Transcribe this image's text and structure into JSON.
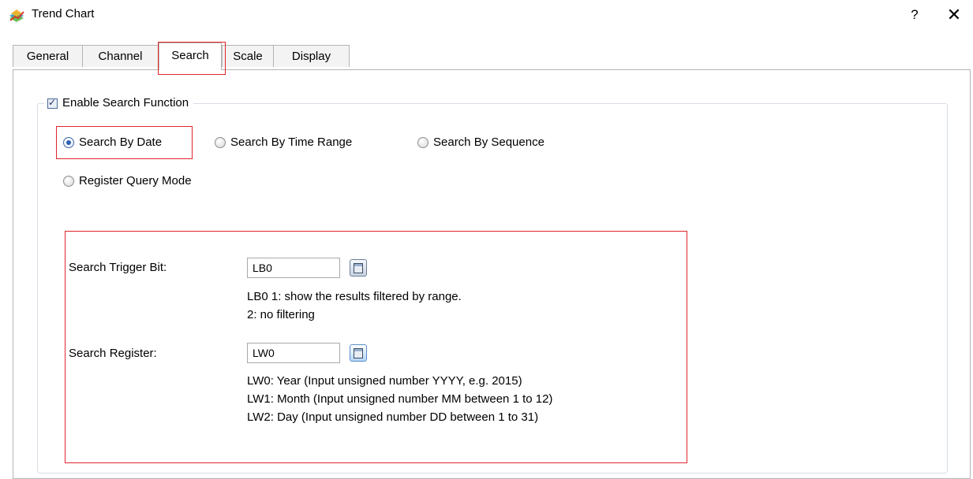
{
  "window": {
    "title": "Trend Chart",
    "help_label": "?",
    "close_label": "✕"
  },
  "tabs": [
    {
      "label": "General",
      "active": false
    },
    {
      "label": "Channel",
      "active": false
    },
    {
      "label": "Search",
      "active": true
    },
    {
      "label": "Scale",
      "active": false
    },
    {
      "label": "Display",
      "active": false
    }
  ],
  "search": {
    "enable_label": "Enable Search Function",
    "enabled": true,
    "modes": [
      {
        "label": "Search By Date",
        "selected": true
      },
      {
        "label": "Search By Time Range",
        "selected": false
      },
      {
        "label": "Search By Sequence",
        "selected": false
      },
      {
        "label": "Register Query Mode",
        "selected": false
      }
    ],
    "trigger": {
      "label": "Search Trigger Bit:",
      "value": "LB0",
      "help_lines": [
        "LB0 1: show the results filtered by range.",
        "2: no filtering"
      ]
    },
    "register": {
      "label": "Search Register:",
      "value": "LW0",
      "help_lines": [
        "LW0: Year (Input unsigned number YYYY, e.g. 2015)",
        "LW1: Month (Input unsigned number MM between 1 to 12)",
        "LW2: Day (Input unsigned number DD between 1 to 31)"
      ]
    }
  },
  "colors": {
    "highlight": "#e0262c",
    "accent": "#2c60b0",
    "border": "#b4b4b4"
  }
}
